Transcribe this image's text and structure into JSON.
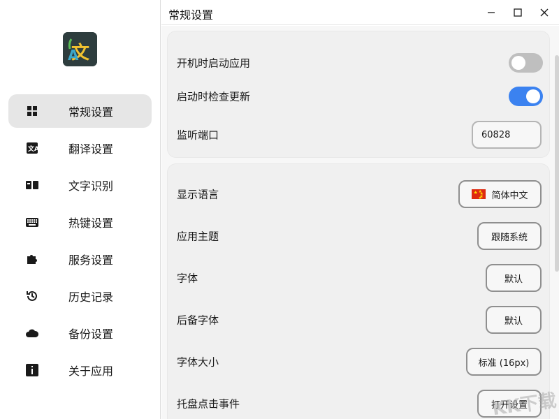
{
  "app": {
    "title": "常规设置"
  },
  "sidebar": {
    "items": [
      {
        "label": "常规设置",
        "icon": "grid-icon",
        "active": true
      },
      {
        "label": "翻译设置",
        "icon": "translate-icon",
        "active": false
      },
      {
        "label": "文字识别",
        "icon": "ocr-icon",
        "active": false
      },
      {
        "label": "热键设置",
        "icon": "keyboard-icon",
        "active": false
      },
      {
        "label": "服务设置",
        "icon": "puzzle-icon",
        "active": false
      },
      {
        "label": "历史记录",
        "icon": "history-icon",
        "active": false
      },
      {
        "label": "备份设置",
        "icon": "cloud-icon",
        "active": false
      },
      {
        "label": "关于应用",
        "icon": "info-icon",
        "active": false
      }
    ]
  },
  "window": {
    "minimize": "minimize-icon",
    "maximize": "maximize-icon",
    "close": "close-icon"
  },
  "settings": {
    "auto_start": {
      "label": "开机时启动应用",
      "enabled": false
    },
    "check_update": {
      "label": "启动时检查更新",
      "enabled": true
    },
    "port": {
      "label": "监听端口",
      "value": "60828"
    },
    "display_language": {
      "label": "显示语言",
      "value": "简体中文"
    },
    "theme": {
      "label": "应用主题",
      "value": "跟随系统"
    },
    "font": {
      "label": "字体",
      "value": "默认"
    },
    "fallback_font": {
      "label": "后备字体",
      "value": "默认"
    },
    "font_size": {
      "label": "字体大小",
      "value": "标准 (16px)"
    },
    "tray_click": {
      "label": "托盘点击事件",
      "value": "打开设置"
    }
  },
  "colors": {
    "accent": "#3b82f0",
    "toggle_off": "#bfbfbf",
    "active_nav": "#e6e6e6"
  },
  "watermark": "KK下载"
}
